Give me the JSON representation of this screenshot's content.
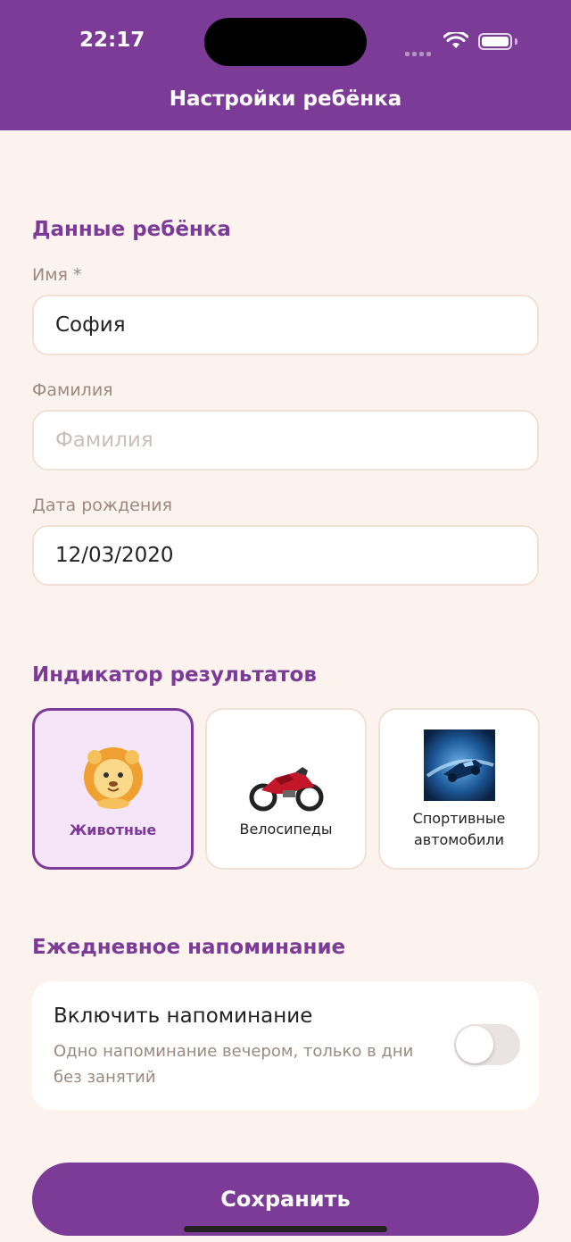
{
  "status_bar": {
    "time": "22:17"
  },
  "header": {
    "title": "Настройки ребёнка"
  },
  "child_section": {
    "title": "Данные ребёнка",
    "first_name": {
      "label": "Имя *",
      "value": "София"
    },
    "last_name": {
      "label": "Фамилия",
      "value": "",
      "placeholder": "Фамилия"
    },
    "birth_date": {
      "label": "Дата рождения",
      "value": "12/03/2020"
    }
  },
  "indicator_section": {
    "title": "Индикатор результатов",
    "options": [
      {
        "label": "Животные",
        "icon": "lion-icon",
        "selected": true
      },
      {
        "label": "Велосипеды",
        "icon": "motorcycle-icon",
        "selected": false
      },
      {
        "label_line1": "Спортивные",
        "label_line2": "автомобили",
        "icon": "sports-car-icon",
        "selected": false
      }
    ]
  },
  "reminder_section": {
    "title": "Ежедневное напоминание",
    "toggle_title": "Включить напоминание",
    "toggle_description": "Одно напоминание вечером, только в дни без занятий",
    "enabled": false
  },
  "save_button": {
    "label": "Сохранить"
  },
  "colors": {
    "accent": "#7b3b96",
    "background": "#fdf3ee"
  }
}
